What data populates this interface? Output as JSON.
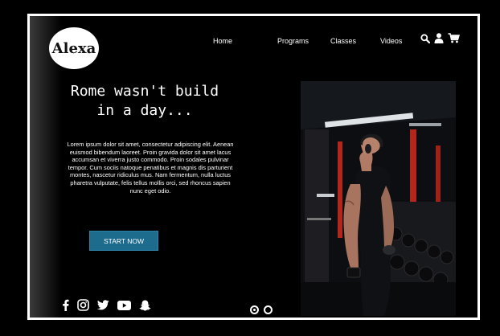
{
  "brand": {
    "name": "Alexa"
  },
  "nav": {
    "items": [
      {
        "label": "Home"
      },
      {
        "label": "Programs"
      },
      {
        "label": "Classes"
      },
      {
        "label": "Videos"
      }
    ]
  },
  "header_icons": [
    "search-icon",
    "user-icon",
    "cart-icon"
  ],
  "hero": {
    "headline": "Rome wasn't build in a day...",
    "body": "Lorem ipsum dolor sit amet, consectetur adipiscing elit. Aenean euismod bibendum laoreet. Proin gravida dolor sit amet lacus accumsan et viverra justo commodo. Proin sodales pulvinar tempor. Cum sociis natoque penatibus et magnis dis parturient montes, nascetur ridiculus mus. Nam fermentum, nulla luctus pharetra vulputate, felis tellus mollis orci, sed rhoncus sapien nunc eget odio.",
    "cta_label": "START NOW"
  },
  "social_icons": [
    "facebook-icon",
    "instagram-icon",
    "twitter-icon",
    "youtube-icon",
    "snapchat-icon"
  ],
  "colors": {
    "background": "#000000",
    "frame": "#ffffff",
    "accent": "#1d6b8d"
  }
}
